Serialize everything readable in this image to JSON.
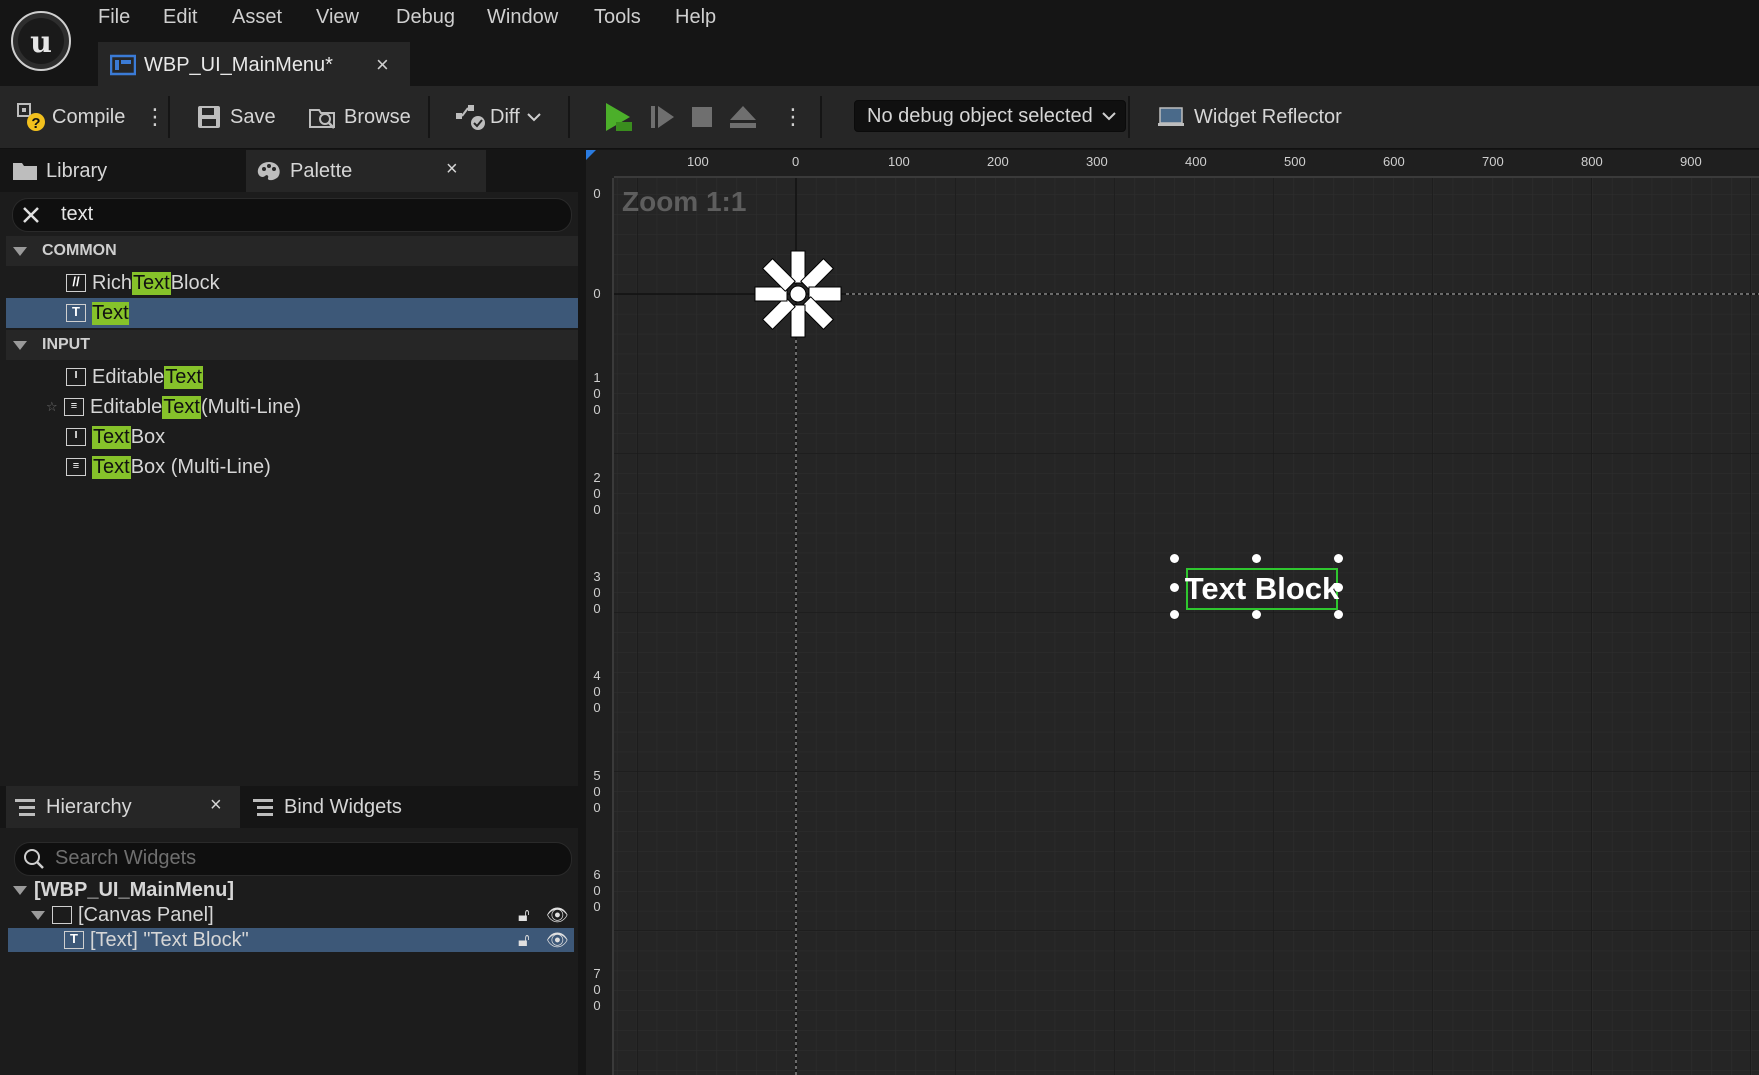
{
  "menu": {
    "logo_icon": "unreal-engine-logo",
    "items": [
      "File",
      "Edit",
      "Asset",
      "View",
      "Debug",
      "Window",
      "Tools",
      "Help"
    ]
  },
  "document_tab": {
    "label": "WBP_UI_MainMenu*",
    "close": "×",
    "icon": "widget-blueprint-icon"
  },
  "toolbar": {
    "compile": "Compile",
    "save": "Save",
    "browse": "Browse",
    "diff": "Diff",
    "debug_object": "No debug object selected",
    "widget_reflector": "Widget Reflector"
  },
  "library_panel": {
    "tab_library": "Library",
    "tab_palette": "Palette",
    "close": "×",
    "search_value": "text",
    "categories": [
      {
        "label": "COMMON",
        "items": [
          {
            "pre": "Rich ",
            "hl": "Text",
            "post": " Block",
            "icon": "rich-text-icon"
          },
          {
            "pre": "",
            "hl": "Text",
            "post": "",
            "icon": "text-icon",
            "selected": true
          }
        ]
      },
      {
        "label": "INPUT",
        "items": [
          {
            "pre": "Editable ",
            "hl": "Text",
            "post": "",
            "icon": "editable-text-icon"
          },
          {
            "pre": "Editable ",
            "hl": "Text",
            "post": " (Multi-Line)",
            "icon": "editable-text-multiline-icon"
          },
          {
            "pre": "",
            "hl": "Text",
            "post": " Box",
            "icon": "text-box-icon"
          },
          {
            "pre": "",
            "hl": "Text",
            "post": " Box (Multi-Line)",
            "icon": "text-box-multiline-icon"
          }
        ]
      }
    ]
  },
  "hierarchy_panel": {
    "tab_hierarchy": "Hierarchy",
    "close": "×",
    "tab_bind": "Bind Widgets",
    "search_placeholder": "Search Widgets",
    "root": "[WBP_UI_MainMenu]",
    "canvas": "[Canvas Panel]",
    "text_node": "[Text] \"Text Block\""
  },
  "designer": {
    "zoom_label": "Zoom 1:1",
    "ruler_top": [
      "100",
      "0",
      "100",
      "200",
      "300",
      "400",
      "500",
      "600",
      "700",
      "800",
      "900"
    ],
    "ruler_left": [
      "0",
      "0",
      "100",
      "200",
      "300",
      "400",
      "500",
      "600",
      "700"
    ],
    "text_block": "Text Block"
  },
  "colors": {
    "highlight": "#86c22a",
    "selection": "#3d5878",
    "widget_outline": "#2fc72f",
    "play": "#4caf2a"
  }
}
